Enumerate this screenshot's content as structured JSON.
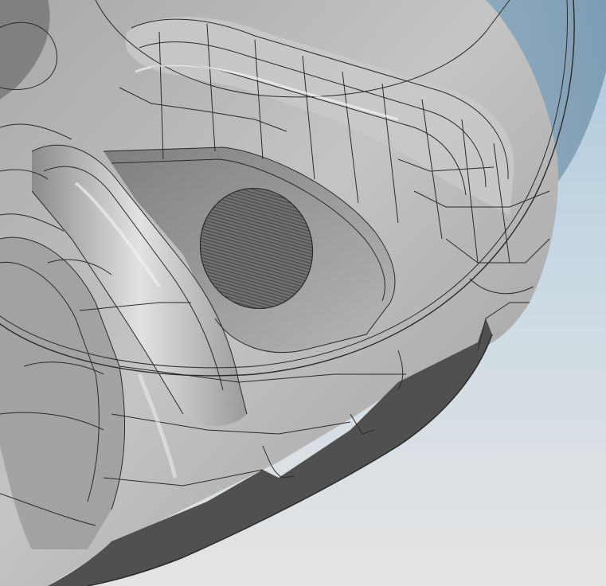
{
  "viewport": {
    "background_top": "#a9c8de",
    "background_bottom": "#e4e4e4",
    "model_body_color": "#b9b9b9",
    "model_shadow_color": "#8f8f8f",
    "model_dark_face_color": "#505050",
    "edge_line_color": "#2a2a2a",
    "hatch_color": "#3c3c3c",
    "glass_color": "#d8dee4"
  }
}
